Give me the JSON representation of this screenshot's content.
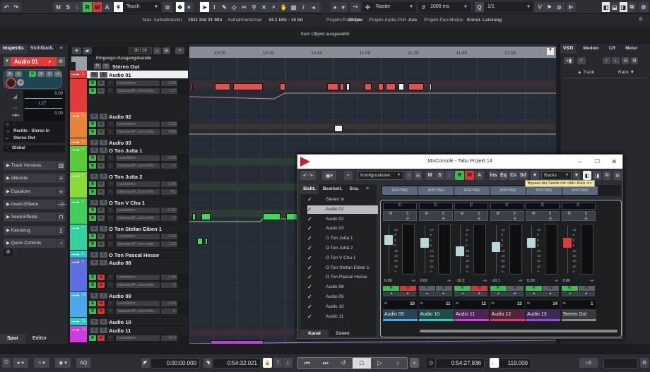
{
  "toolbar": {
    "undo_icon": "undo-icon",
    "redo_icon": "redo-icon",
    "mode_buttons": [
      "M",
      "S",
      "L",
      "R",
      "W",
      "A"
    ],
    "automation_mode": "Touch",
    "snap_type": "Raster",
    "grid": "1000 ms",
    "quantize": "1/1"
  },
  "infoline": {
    "max_rec_label": "Max. Aufnahmezeit",
    "max_rec_value": "1611 Std 31 Min",
    "rec_format_label": "Aufnahmeformat",
    "rec_format_value": "44.1 kHz - 16 bit",
    "framerate_label": "Projekt-Framerate",
    "framerate_value": "30 fps",
    "audio_pull_label": "Projekt-Audio-Pull",
    "audio_pull_value": "Aus",
    "pan_mode_label": "Projekt-Pan-Modus",
    "pan_mode_value": "Konst. Leistung"
  },
  "selection_status": "Kein Objekt ausgewählt",
  "inspector": {
    "tabs": [
      "Inspecto.",
      "Sichtbark."
    ],
    "track_name": "Audio 01",
    "volume": "0.00",
    "pan": "L17",
    "third": "0.00",
    "routing_none": "-",
    "input": "Rechts - Stereo In",
    "output": "Stereo Out",
    "global": "Global",
    "sections": [
      "Track Versions",
      "Akkorde",
      "Equalizer",
      "Insert-Effekte",
      "Send-Effekte",
      "Kanalzug",
      "Quick Controls"
    ],
    "bottom_tabs": [
      "Spur",
      "Editor"
    ]
  },
  "tracklist": {
    "count": "16 / 16",
    "folder": "Eingangs-/Ausgangskanäle",
    "stereo_out": "Stereo Out",
    "tracks": [
      {
        "num": "1",
        "name": "Audio 01",
        "color": "#e5393b",
        "lanes": [
          [
            "Lautstärke",
            "0.00"
          ],
          [
            "StandardP...ks/rechts",
            "L17"
          ]
        ]
      },
      {
        "num": "2",
        "name": "Audio 02",
        "color": "#e8843a",
        "lanes": [
          [
            "Lautstärke",
            "0.00"
          ],
          [
            "StandardP...ks/rechts",
            "R28"
          ]
        ]
      },
      {
        "num": "3",
        "name": "Audio 03",
        "color": "#e8843a",
        "lanes": []
      },
      {
        "num": "4",
        "name": "O Ton Jutta 1",
        "color": "#55cc3a",
        "lanes": [
          [
            "Lautstärke",
            "0.09"
          ],
          [
            "StandardP...ks/rechts",
            "C"
          ]
        ]
      },
      {
        "num": "5",
        "name": "O Ton Jutta 2",
        "color": "#8bd93a",
        "lanes": [
          [
            "Lautstärke",
            "0.05"
          ],
          [
            "StandardP...ks/rechts",
            "R1"
          ]
        ]
      },
      {
        "num": "6",
        "name": "O Ton V Chu 1",
        "color": "#3fcf5a",
        "lanes": [
          [
            "Lautstärke",
            "0.01"
          ],
          [
            "StandardP...ks/rechts",
            "C"
          ]
        ]
      },
      {
        "num": "7",
        "name": "O Ton Stefan Eiben 1",
        "color": "#33d0a0",
        "lanes": [
          [
            "Lautstärke",
            "0.02"
          ],
          [
            "StandardP...ks/rechts",
            "L19"
          ]
        ]
      },
      {
        "num": "8",
        "name": "O Ton Pascal Hesse",
        "color": "#2bc9c0",
        "lanes": []
      },
      {
        "num": "9",
        "name": "Audio 08",
        "color": "#5b6fe0",
        "lanes": [
          [
            "Lautstärke",
            "1.99"
          ],
          [
            "StandardP...ks/rechts",
            "C"
          ]
        ]
      },
      {
        "num": "10",
        "name": "Audio 09",
        "color": "#4aa8e8",
        "lanes": [
          [
            "Lautstärke",
            "0.09"
          ],
          [
            "StandardP...ks/rechts",
            "C"
          ]
        ]
      },
      {
        "num": "11",
        "name": "Audio 10",
        "color": "#2bc9c0",
        "lanes": []
      },
      {
        "num": "12",
        "name": "Audio 11",
        "color": "#d03ae0",
        "lanes": [
          [
            "Lautstärke",
            "-10.2"
          ]
        ]
      }
    ]
  },
  "ruler": [
    "10:00",
    "10:20",
    "10:40",
    "11:00",
    "11:20",
    "11:40",
    "12:00"
  ],
  "right_zone": {
    "tabs": [
      "VSTi",
      "Medien",
      "CR",
      "Meter"
    ],
    "track_label": "Track",
    "rack_label": "Rack"
  },
  "mixconsole": {
    "title": "MixConsole - Tabu Projekt 14",
    "config": "Konfiguratione.",
    "mode_buttons": [
      "M",
      "S",
      "L",
      "R",
      "W",
      "A"
    ],
    "rack_buttons": [
      "Ins",
      "Eq",
      "Cs",
      "Sd"
    ],
    "racks": "Racks",
    "tooltip": "Bypass der Sends mit <Alt>-Klick <I>",
    "left_tabs": [
      "Sicht.",
      "Bearbeit.",
      "Sna."
    ],
    "bottom_tabs": [
      "Kanal",
      "Zonen"
    ],
    "channels": [
      "Stereo In",
      "Audio 01",
      "Audio 02",
      "Audio 03",
      "O Ton Jutta 1",
      "O Ton Jutta 2",
      "O Ton V Chu 1",
      "O Ton Stefan Eiben 1",
      "O Ton Pascal Hesse",
      "Audio 08",
      "Audio 09",
      "Audio 10",
      "Audio 11"
    ],
    "routing_label": "ROUTING",
    "scale": [
      "12",
      "6",
      "0",
      "5",
      "10",
      "15",
      "20",
      "30",
      "∞"
    ],
    "strips": [
      {
        "name": "Audio 09",
        "num": "10",
        "level": "0.09",
        "peak": "-∞",
        "color": "#4aa8e8",
        "fader_red": false,
        "r_on": true,
        "w_on": true
      },
      {
        "name": "Audio 10",
        "num": "11",
        "level": "0.00",
        "peak": "-∞",
        "color": "#2bc9c0",
        "fader_red": false,
        "r_on": false,
        "w_on": false
      },
      {
        "name": "Audio 11",
        "num": "12",
        "level": "-10.2",
        "peak": "-∞",
        "color": "#d03ae0",
        "fader_red": false,
        "r_on": true,
        "w_on": true
      },
      {
        "name": "Audio 12",
        "num": "13",
        "level": "-10.1",
        "peak": "-∞",
        "color": "#e03a7a",
        "fader_red": false,
        "r_on": true,
        "w_on": false
      },
      {
        "name": "Audio 13",
        "num": "14",
        "level": "0.00",
        "peak": "-∞",
        "color": "#9a4ae0",
        "fader_red": false,
        "r_on": true,
        "w_on": false
      },
      {
        "name": "Stereo Out",
        "num": "1",
        "level": "0.00",
        "peak": "-∞",
        "color": "#888888",
        "fader_red": true,
        "r_on": true,
        "w_on": false
      }
    ]
  },
  "transport": {
    "aq": "AQ",
    "left_locator": "0:00:00.000",
    "right_locator": "0:54:32.021",
    "position": "0:54:27.936",
    "tempo": "119.000"
  }
}
